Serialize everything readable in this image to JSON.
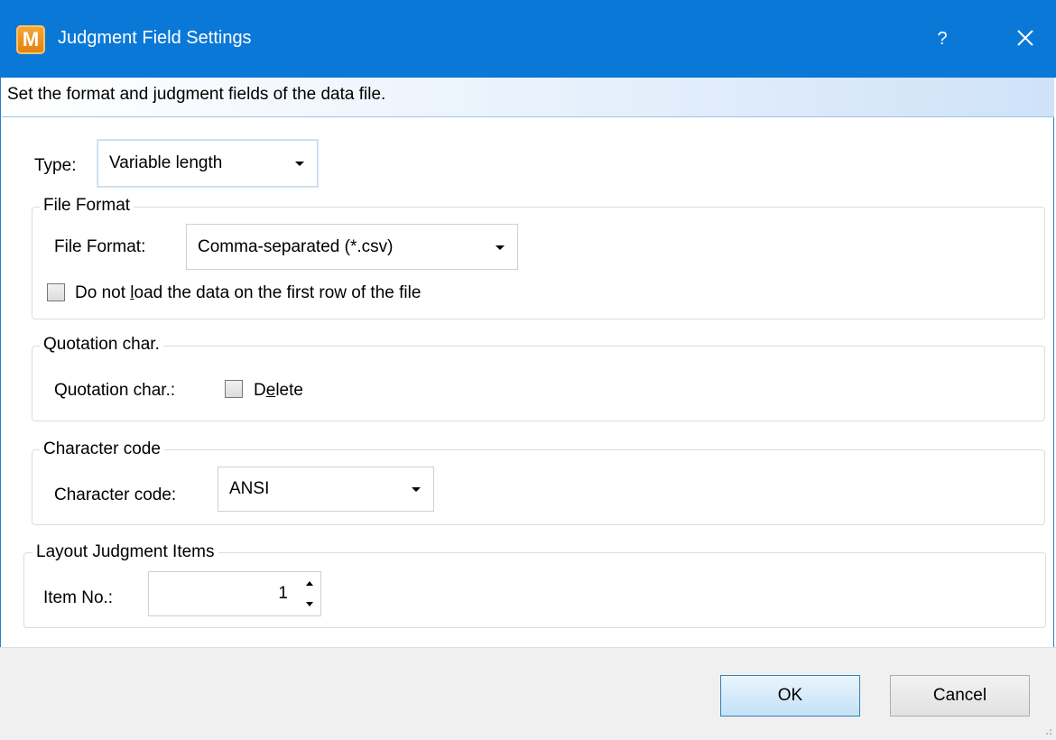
{
  "window": {
    "app_icon_letter": "M",
    "title": "Judgment Field Settings",
    "help_label": "?",
    "accent_color": "#0a78d7"
  },
  "banner": {
    "text": "Set the format and judgment fields of the data file."
  },
  "type": {
    "label": "Type:",
    "value": "Variable length"
  },
  "file_format_group": {
    "legend": "File Format",
    "label": "File Format:",
    "value": "Comma-separated (*.csv)",
    "checkbox_pre": "Do not ",
    "checkbox_accel": "l",
    "checkbox_post": "oad the data on the first row of the file",
    "checkbox_checked": false
  },
  "quotation_group": {
    "legend": "Quotation char.",
    "label": "Quotation char.:",
    "checkbox_pre": "D",
    "checkbox_accel": "e",
    "checkbox_post": "lete",
    "checkbox_checked": false
  },
  "charcode_group": {
    "legend": "Character code",
    "label": "Character code:",
    "value": "ANSI"
  },
  "layout_group": {
    "legend": "Layout Judgment Items",
    "label": "Item No.:",
    "value": "1"
  },
  "buttons": {
    "ok": "OK",
    "cancel": "Cancel"
  }
}
